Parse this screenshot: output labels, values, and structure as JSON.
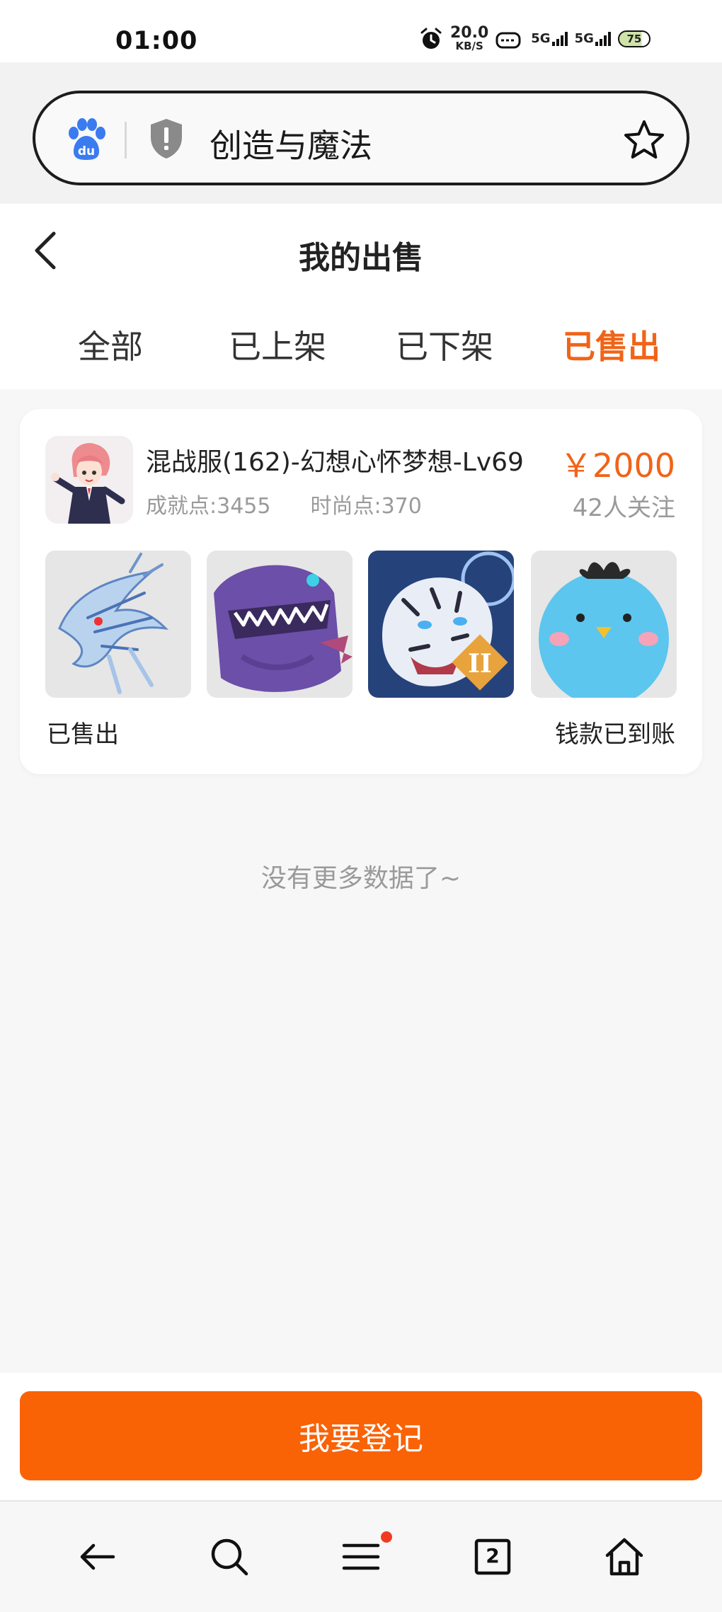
{
  "status_bar": {
    "time": "01:00",
    "net_speed_value": "20.0",
    "net_speed_unit": "KB/S",
    "signal_label_1": "5G",
    "signal_label_2": "5G",
    "battery_level": "75"
  },
  "browser": {
    "search_text": "创造与魔法",
    "tab_count": "2"
  },
  "page": {
    "title": "我的出售",
    "tabs": [
      {
        "label": "全部"
      },
      {
        "label": "已上架"
      },
      {
        "label": "已下架"
      },
      {
        "label": "已售出"
      }
    ],
    "active_tab": "已售出"
  },
  "listing": {
    "title": "混战服(162)-幻想心怀梦想-Lv69",
    "achievement": "成就点:3455",
    "fashion": "时尚点:370",
    "price": "￥2000",
    "followers": "42人关注",
    "status": "已售出",
    "payment_status": "钱款已到账",
    "thumbnails": [
      {
        "icon": "ice-dragon-image"
      },
      {
        "icon": "purple-dinosaur-image"
      },
      {
        "icon": "white-tiger-image"
      },
      {
        "icon": "blue-bird-image"
      }
    ]
  },
  "no_more": "没有更多数据了~",
  "action": {
    "register_label": "我要登记"
  },
  "colors": {
    "accent": "#f06418",
    "button": "#fa6206",
    "muted_text": "#9a9a9a"
  }
}
